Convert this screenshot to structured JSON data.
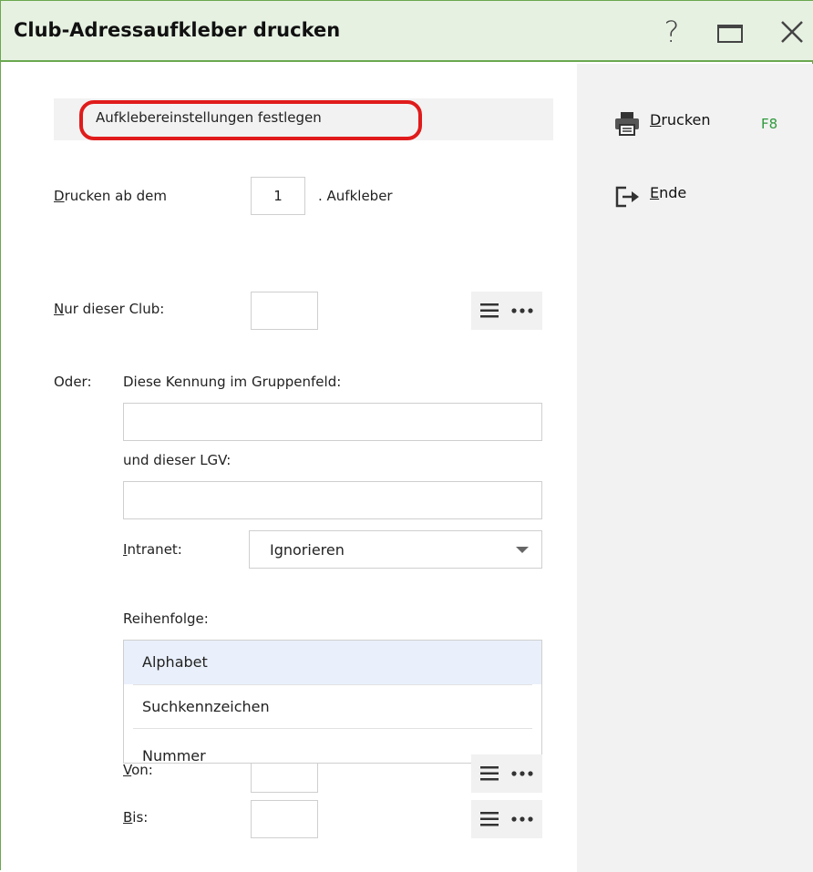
{
  "window": {
    "title": "Club-Adressaufkleber drucken",
    "help_glyph": "?"
  },
  "section": {
    "label": "Aufklebereinstellungen festlegen"
  },
  "form": {
    "drucken_ab": {
      "label_u": "D",
      "label_rest": "rucken ab dem",
      "value": "1",
      "suffix": ". Aufkleber"
    },
    "nur_club": {
      "label_u": "N",
      "label_rest": "ur dieser Club:",
      "value": ""
    },
    "oder_label": "Oder:",
    "kennung_label": "Diese Kennung im Gruppenfeld:",
    "kennung_value": "",
    "lgv_label": "und dieser LGV:",
    "lgv_value": "",
    "intranet": {
      "label_u": "I",
      "label_rest": "ntranet:",
      "selected": "Ignorieren"
    },
    "reihenfolge_label": "Reihenfolge:",
    "reihenfolge_options": [
      "Alphabet",
      "Suchkennzeichen",
      "Nummer"
    ],
    "reihenfolge_selected": "Alphabet",
    "von": {
      "label_u": "V",
      "label_rest": "on:",
      "value": ""
    },
    "bis": {
      "label_u": "B",
      "label_rest": "is:",
      "value": ""
    }
  },
  "actions": {
    "print": {
      "label_u": "D",
      "label_rest": "rucken",
      "shortcut": "F8",
      "icon": "printer-icon"
    },
    "exit": {
      "label_u": "E",
      "label_rest": "nde",
      "icon": "exit-icon"
    }
  },
  "colors": {
    "title_bg": "#e6f1e2",
    "border_green": "#6aa84f",
    "highlight_red": "#e01b1b",
    "shortcut_green": "#2e9a3c",
    "list_selected": "#e9f0fb"
  }
}
